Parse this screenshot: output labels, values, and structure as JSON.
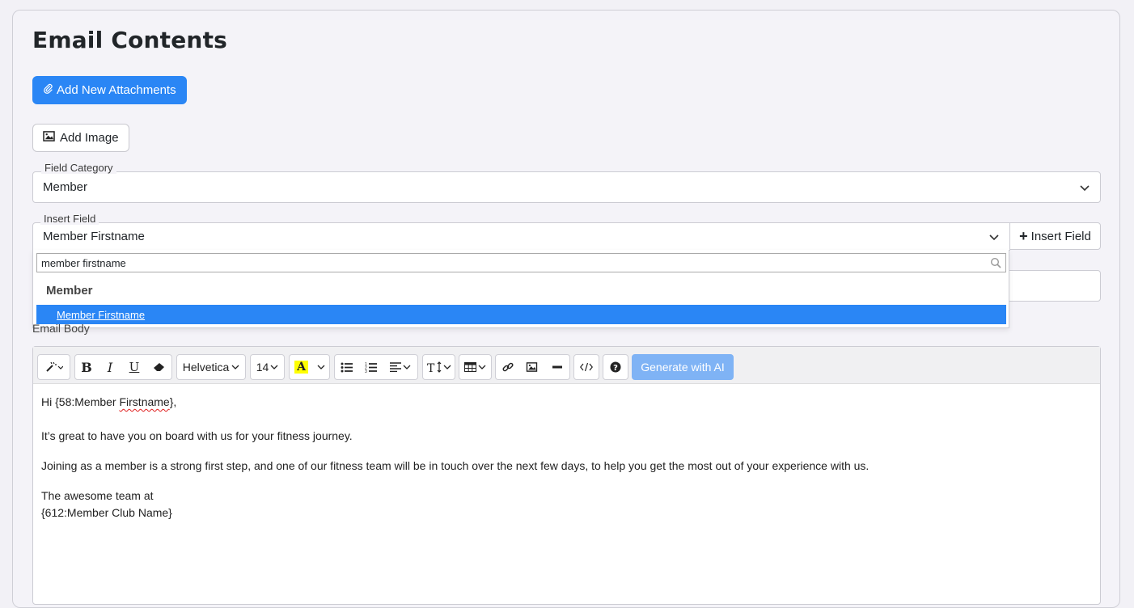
{
  "page": {
    "title": "Email Contents"
  },
  "buttons": {
    "add_attachments": "Add New Attachments",
    "add_image": "Add Image",
    "insert_field": "Insert Field"
  },
  "field_category": {
    "legend": "Field Category",
    "value": "Member"
  },
  "insert_field": {
    "legend": "Insert Field",
    "value": "Member Firstname",
    "search_value": "member firstname",
    "group_label": "Member",
    "highlighted_option": "Member Firstname"
  },
  "email_body": {
    "label": "Email Body"
  },
  "toolbar": {
    "font_name": "Helvetica",
    "font_size": "14",
    "generate_ai": "Generate with AI"
  },
  "body": {
    "greeting_prefix": "Hi {58:Member ",
    "greeting_word": "Firstname",
    "greeting_suffix": "},",
    "line1": "It’s great to have you on board with us for your fitness journey.",
    "line2": "Joining as a member is a strong first step, and one of our fitness team will be in touch over the next few days, to help you get the most out of your experience with us.",
    "signoff1": "The awesome team at",
    "signoff2": "{612:Member Club Name}"
  },
  "colors": {
    "primary": "#2a86f5",
    "ai_button": "#7fb3f5",
    "highlight_yellow": "#ffff00"
  }
}
